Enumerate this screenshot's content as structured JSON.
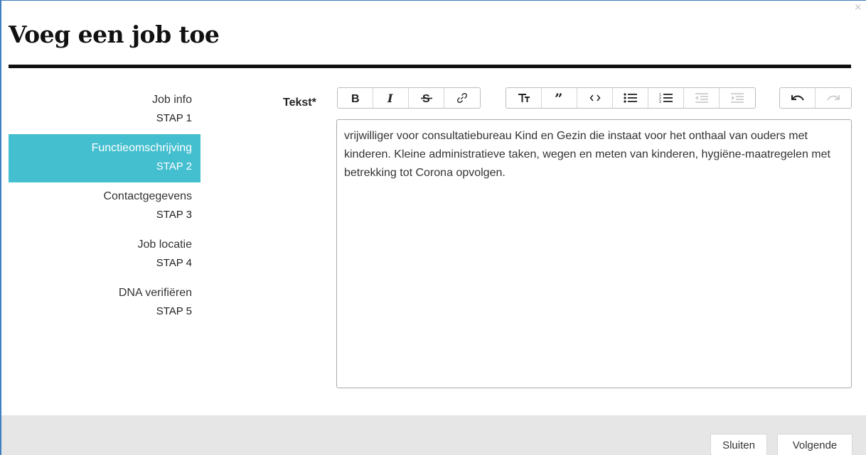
{
  "dialog": {
    "title": "Voeg een job toe",
    "close_glyph": "×"
  },
  "steps": [
    {
      "label": "Job info",
      "num": "STAP 1",
      "active": false
    },
    {
      "label": "Functieomschrijving",
      "num": "STAP 2",
      "active": true
    },
    {
      "label": "Contactgegevens",
      "num": "STAP 3",
      "active": false
    },
    {
      "label": "Job locatie",
      "num": "STAP 4",
      "active": false
    },
    {
      "label": "DNA verifiëren",
      "num": "STAP 5",
      "active": false
    }
  ],
  "field": {
    "label": "Tekst*",
    "value": "vrijwilliger voor consultatiebureau Kind en Gezin die instaat voor het onthaal van ouders met kinderen. Kleine administratieve taken, wegen en meten van kinderen, hygiëne-maatregelen met betrekking tot Corona opvolgen."
  },
  "toolbar": {
    "groups": [
      [
        "bold-icon",
        "italic-icon",
        "strikethrough-icon",
        "link-icon"
      ],
      [
        "heading-icon",
        "quote-icon",
        "code-icon",
        "bullet-list-icon",
        "numbered-list-icon",
        "outdent-icon",
        "indent-icon"
      ],
      [
        "undo-icon",
        "redo-icon"
      ]
    ],
    "disabled": [
      "outdent-icon",
      "indent-icon",
      "redo-icon"
    ]
  },
  "footer": {
    "close_label": "Sluiten",
    "next_label": "Volgende"
  },
  "colors": {
    "active_step": "#44bfcf",
    "border": "#3f7fc0"
  }
}
